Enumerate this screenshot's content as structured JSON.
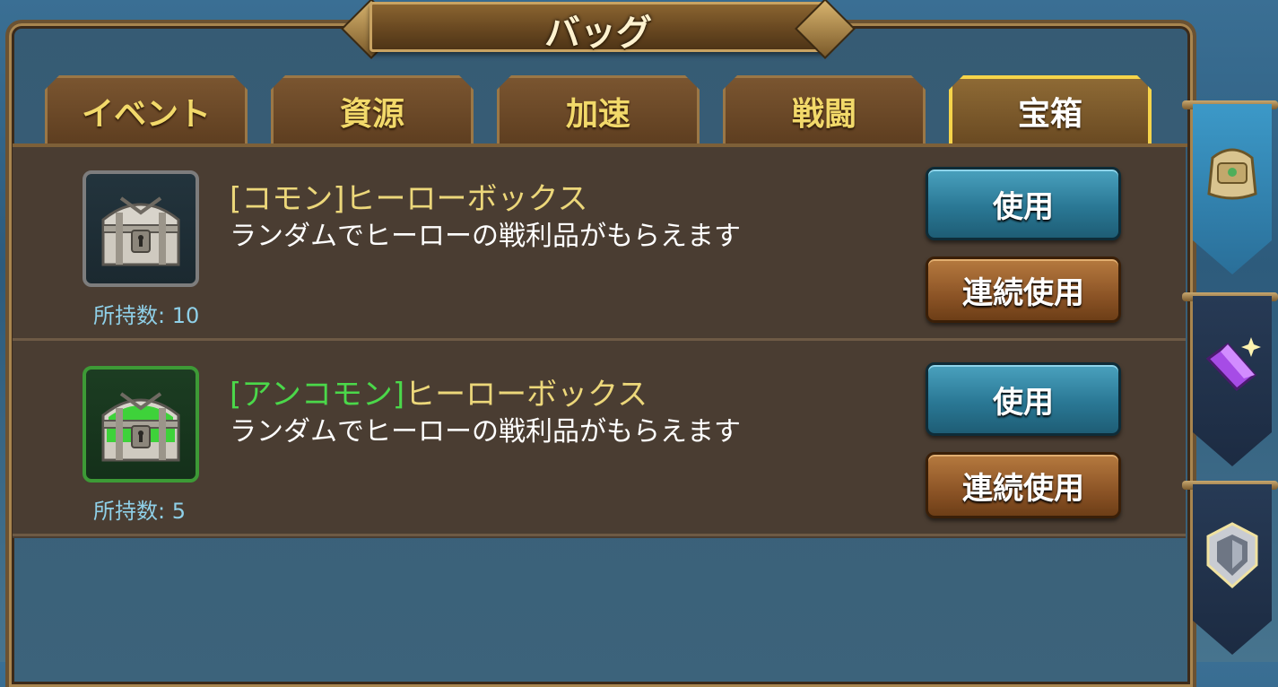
{
  "window": {
    "title": "バッグ"
  },
  "tabs": [
    {
      "label": "イベント",
      "active": false
    },
    {
      "label": "資源",
      "active": false
    },
    {
      "label": "加速",
      "active": false
    },
    {
      "label": "戦闘",
      "active": false
    },
    {
      "label": "宝箱",
      "active": true
    }
  ],
  "items": [
    {
      "name_bracket_open": "[",
      "rarity": "コモン",
      "name_bracket_close": "]",
      "name_rest": "ヒーローボックス",
      "description": "ランダムでヒーローの戦利品がもらえます",
      "count_label": "所持数: 10",
      "icon": "common-chest-icon",
      "use_label": "使用",
      "use_multiple_label": "連続使用"
    },
    {
      "name_bracket_open": "[",
      "rarity": "アンコモン",
      "name_bracket_close": "]",
      "name_rest": "ヒーローボックス",
      "description": "ランダムでヒーローの戦利品がもらえます",
      "count_label": "所持数: 5",
      "icon": "uncommon-chest-icon",
      "use_label": "使用",
      "use_multiple_label": "連続使用"
    }
  ],
  "side_tabs": [
    {
      "icon": "bag-icon",
      "active": true
    },
    {
      "icon": "purple-gem-icon",
      "active": false
    },
    {
      "icon": "shield-badge-icon",
      "active": false
    }
  ],
  "colors": {
    "tab_text": "#f2d96a",
    "active_tab_border": "#f6d44a",
    "item_name": "#ecd77a",
    "uncommon_name": "#4bd84a",
    "count_text": "#8fd0e8",
    "use_button": "#2a7895",
    "use_multiple_button": "#8c5426"
  }
}
